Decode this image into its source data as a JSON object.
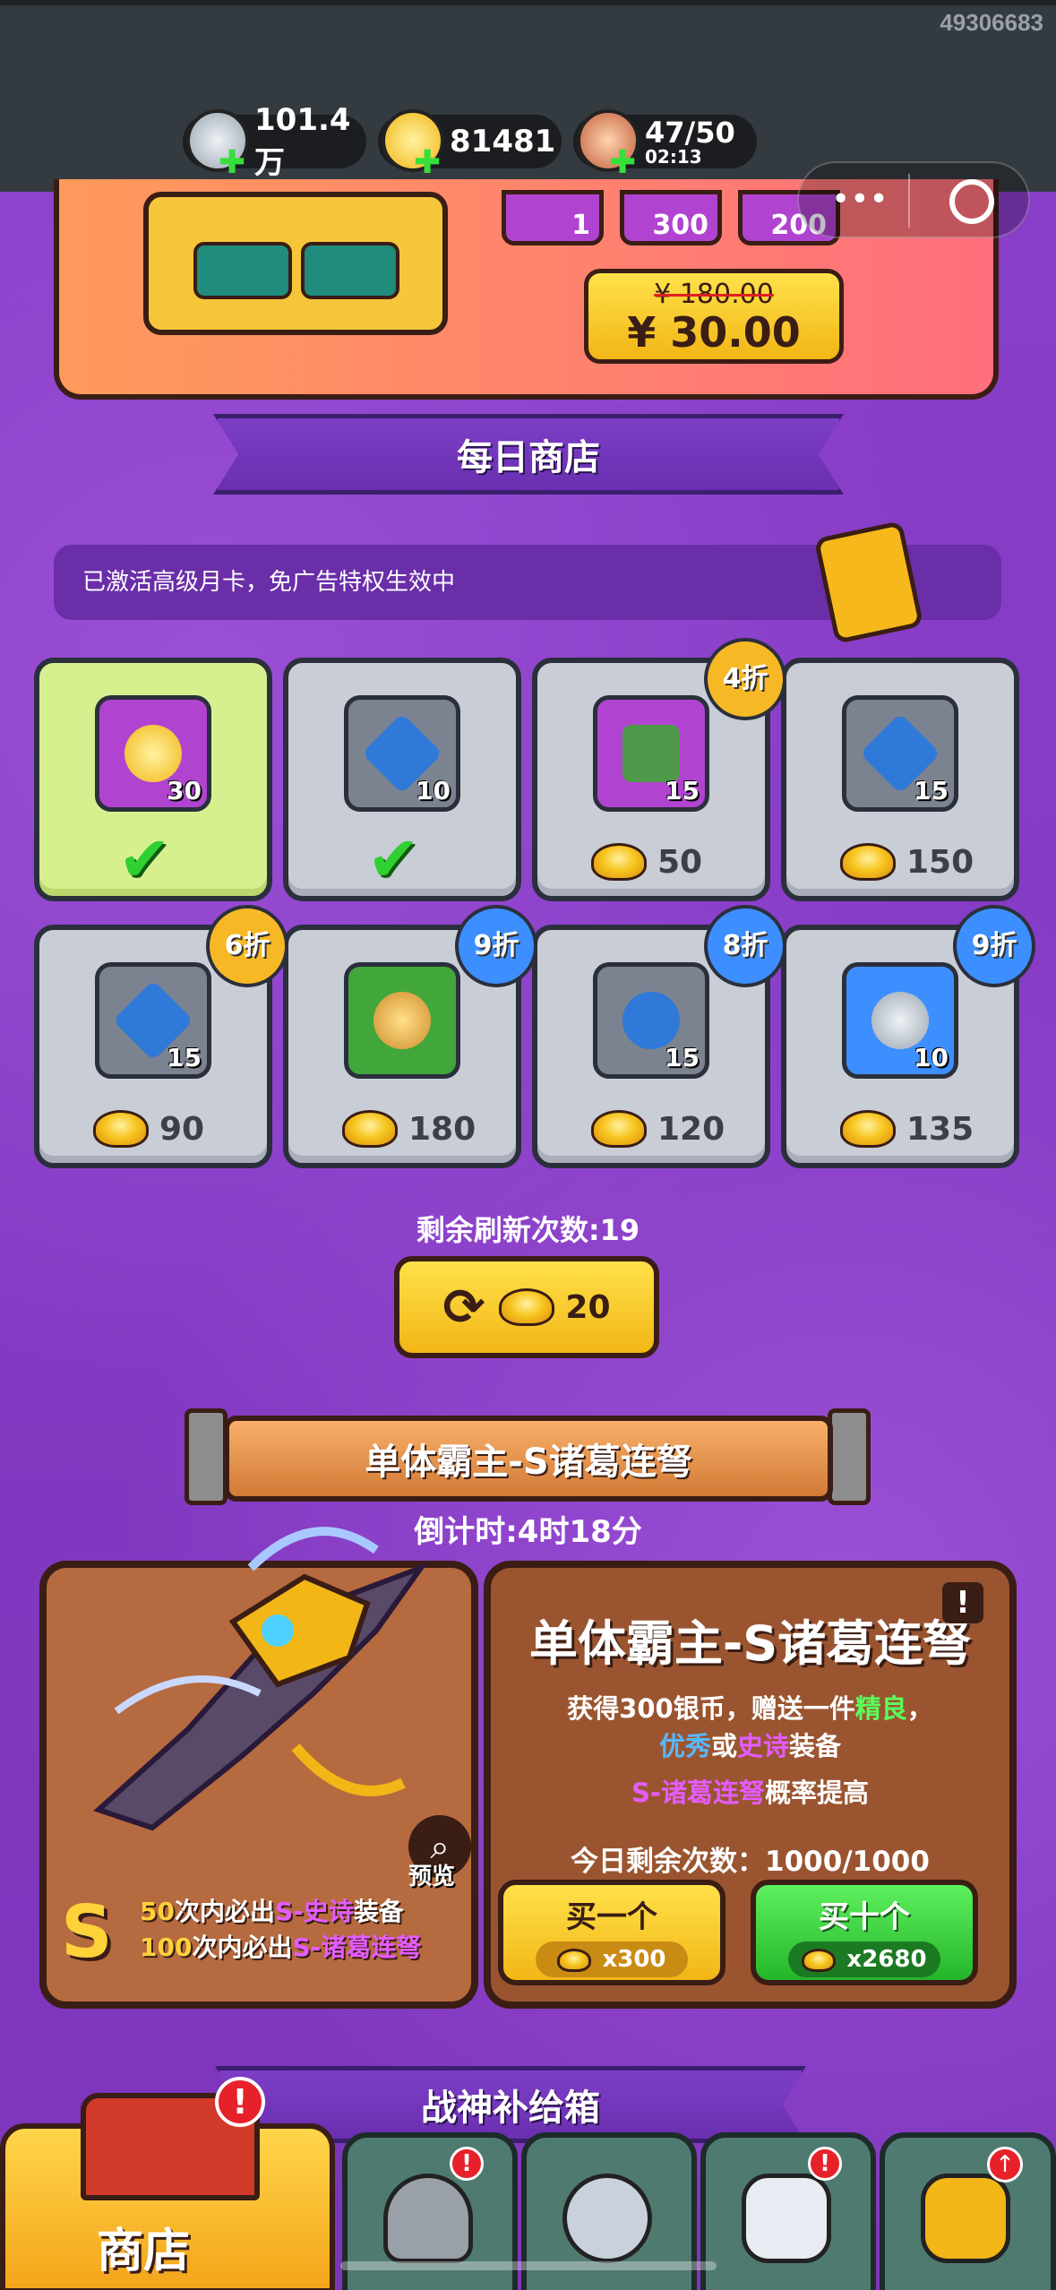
{
  "status": {
    "uid": "49306683",
    "resources": [
      {
        "name": "silver-coin",
        "value": "101.4万"
      },
      {
        "name": "gold-ingot",
        "value": "81481"
      },
      {
        "name": "stamina",
        "value": "47/50",
        "timer": "02:13"
      }
    ]
  },
  "pack": {
    "items": [
      "1",
      "300",
      "200"
    ],
    "old_price": "¥ 180.00",
    "price": "¥ 30.00"
  },
  "daily_shop": {
    "title": "每日商店",
    "notice": "已激活高级月卡，免广告特权生效中",
    "cells": [
      {
        "icon": "gold-ingot",
        "qty": "30",
        "bought": true,
        "cost": null,
        "discount": null
      },
      {
        "icon": "blue-crystal-sword",
        "qty": "10",
        "bought": true,
        "cost": null,
        "discount": null
      },
      {
        "icon": "green-armor",
        "qty": "15",
        "bought": false,
        "cost": "50",
        "discount": "4折"
      },
      {
        "icon": "blue-crystal-sword",
        "qty": "15",
        "bought": false,
        "cost": "150",
        "discount": null
      },
      {
        "icon": "blue-crystal-sword",
        "qty": "15",
        "bought": false,
        "cost": "90",
        "discount": "6折"
      },
      {
        "icon": "jade-pendant",
        "qty": "",
        "bought": false,
        "cost": "180",
        "discount": "9折"
      },
      {
        "icon": "blue-crystal-gem",
        "qty": "15",
        "bought": false,
        "cost": "120",
        "discount": "8折"
      },
      {
        "icon": "silver-coin",
        "qty": "10",
        "bought": false,
        "cost": "135",
        "discount": "9折"
      }
    ],
    "refresh_remaining": "剩余刷新次数:19",
    "refresh_cost": "20"
  },
  "event": {
    "title": "单体霸主-S诸葛连弩",
    "countdown": "倒计时:4时18分",
    "panel_title": "单体霸主-S诸葛连弩",
    "desc_line1": "获得300银币，赠送一件",
    "desc_q1": "精良",
    "desc_sep": "，",
    "desc_q2": "优秀",
    "desc_or": "或",
    "desc_q3": "史诗",
    "desc_end": "装备",
    "rate_item": "S-诸葛连弩",
    "rate_text": "概率提高",
    "remaining": "今日剩余次数：1000/1000",
    "buy_one": {
      "label": "买一个",
      "price": "x300"
    },
    "buy_ten": {
      "label": "买十个",
      "price": "x2680"
    },
    "preview": "预览",
    "guarantee1_num": "50",
    "guarantee1_a": "次内必出",
    "guarantee1_item": "S-史诗",
    "guarantee1_b": "装备",
    "guarantee2_num": "100",
    "guarantee2_a": "次内必出",
    "guarantee2_item": "S-诸葛连弩",
    "grade": "S"
  },
  "supply": {
    "title": "战神补给箱"
  },
  "tabs": [
    {
      "name": "shop",
      "label": "商店",
      "active": true,
      "alert": "!"
    },
    {
      "name": "helmet",
      "alert": "!"
    },
    {
      "name": "swords-shield"
    },
    {
      "name": "hero-stars",
      "alert": "!"
    },
    {
      "name": "upgrade-fist",
      "alert": "↑"
    }
  ],
  "colors": {
    "accent": "#8a3fc4",
    "gold": "#f7c520",
    "green": "#2fd02f",
    "red": "#e7212a",
    "blue": "#3d8fff"
  }
}
